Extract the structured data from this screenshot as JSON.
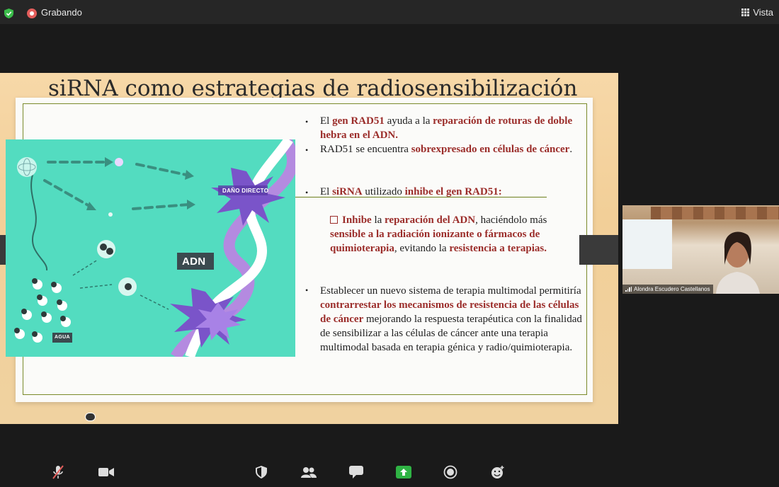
{
  "topbar": {
    "recording_label": "Grabando",
    "view_label": "Vista",
    "colors": {
      "shield": "#3bbd4a",
      "recording": "#e35d5b"
    }
  },
  "slide": {
    "title": "siRNA como estrategias de radiosensibilización",
    "illustration": {
      "label_damage": "DAÑO DIRECTO",
      "label_dna": "ADN",
      "label_water": "AGUA"
    },
    "bullets": [
      {
        "parts": [
          "El ",
          "gen RAD51",
          " ayuda a la ",
          "reparación de roturas de doble hebra en el ADN."
        ]
      },
      {
        "parts": [
          "RAD51 se encuentra ",
          "sobrexpresado en células de cáncer",
          "."
        ]
      },
      {
        "parts": [
          "El ",
          "siRNA",
          " utilizado ",
          "inhibe el gen RAD51:"
        ]
      },
      {
        "parts": [
          "Inhibe",
          " la ",
          "reparación del ADN",
          ", haciéndolo más ",
          "sensible a la radiación ionizante o fármacos de quimioterapia",
          ", evitando la ",
          "resistencia a terapias."
        ]
      },
      {
        "parts": [
          " Establecer un nuevo sistema de terapia multimodal permitiría ",
          "contrarrestar los mecanismos de resistencia de las células de cáncer",
          " mejorando la respuesta terapéutica con la finalidad de sensibilizar a las células de cáncer ante una terapia multimodal basada en terapia génica y radio/quimioterapia."
        ]
      }
    ],
    "colors": {
      "highlight": "#9b2d2a",
      "teal": "#53dcc0",
      "purple": "#7a54c9"
    }
  },
  "participant": {
    "name": "Alondra Escudero Castellanos"
  },
  "bottombar": {
    "icons": [
      "microphone-muted-icon",
      "video-camera-icon",
      "security-shield-icon",
      "participants-icon",
      "chat-icon",
      "share-screen-icon",
      "record-icon",
      "reactions-icon"
    ],
    "colors": {
      "share": "#2fb344"
    }
  }
}
